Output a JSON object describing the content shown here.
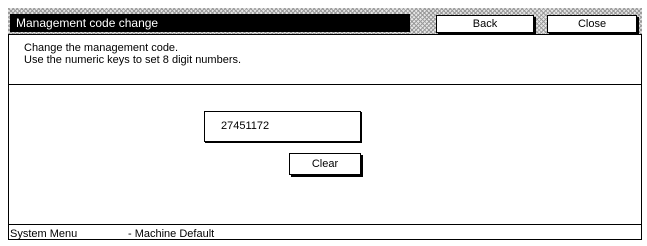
{
  "header": {
    "title": "Management code change",
    "back_label": "Back",
    "close_label": "Close"
  },
  "instructions": {
    "line1": "Change the management code.",
    "line2": "Use the numeric keys to set 8 digit numbers."
  },
  "code_input": {
    "value": "27451172"
  },
  "clear_label": "Clear",
  "breadcrumb": {
    "level1": "System Menu",
    "level2": "-  Machine Default"
  }
}
